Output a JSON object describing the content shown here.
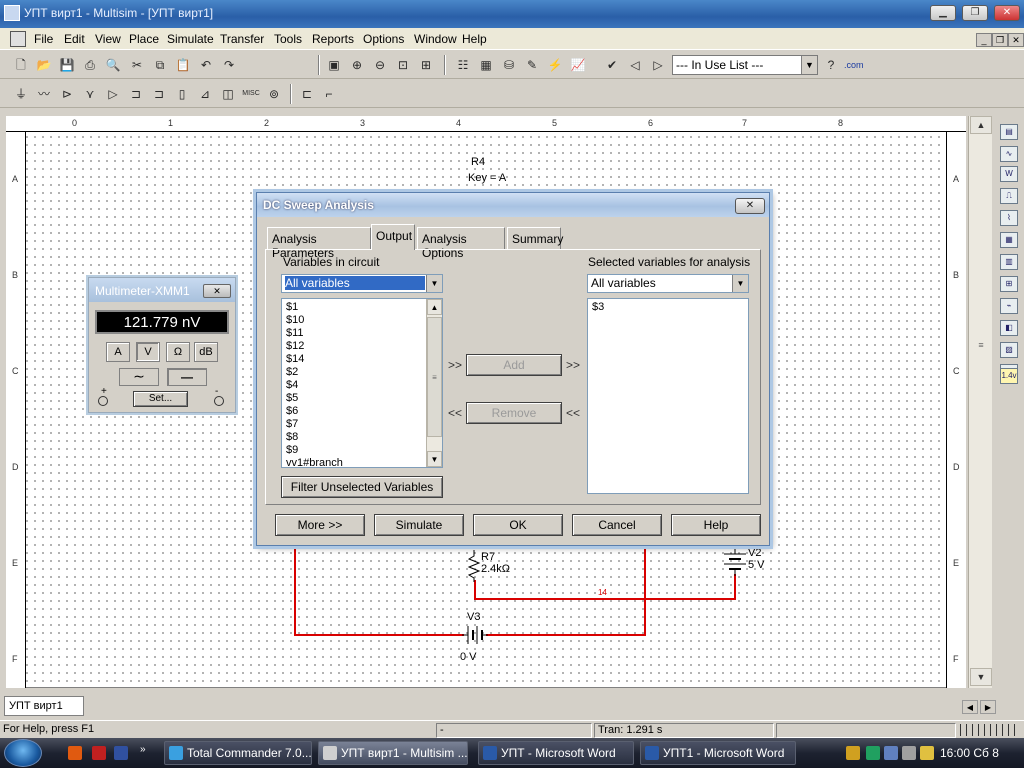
{
  "window": {
    "title": "УПТ вирт1 - Multisim - [УПТ вирт1]",
    "min_label": "▁",
    "max_label": "❐",
    "close_label": "✕"
  },
  "menu": [
    "File",
    "Edit",
    "View",
    "Place",
    "Simulate",
    "Transfer",
    "Tools",
    "Reports",
    "Options",
    "Window",
    "Help"
  ],
  "toolbar": {
    "in_use_list": "--- In Use List ---",
    "help_icon": "?",
    "com_label": ".com"
  },
  "ruler": {
    "top_marks": [
      "0",
      "1",
      "2",
      "3",
      "4",
      "5",
      "6",
      "7",
      "8"
    ],
    "left_marks": [
      "A",
      "B",
      "C",
      "D",
      "E",
      "F"
    ]
  },
  "schematic": {
    "r4_name": "R4",
    "r4_key": "Key = A",
    "r7_name": "R7",
    "r7_value": "2.4kΩ",
    "v2_name": "V2",
    "v2_value": "5 V",
    "v3_name": "V3",
    "v3_value": "0 V",
    "net_label": "14"
  },
  "multimeter": {
    "title": "Multimeter-XMM1",
    "display": "121.779 nV",
    "buttons": [
      "A",
      "V",
      "Ω",
      "dB"
    ],
    "set_label": "Set...",
    "plus": "+",
    "minus": "-"
  },
  "dialog": {
    "title": "DC Sweep Analysis",
    "close_label": "✕",
    "tabs": [
      "Analysis Parameters",
      "Output",
      "Analysis Options",
      "Summary"
    ],
    "active_tab": "Output",
    "variables_label": "Variables in circuit",
    "variables_filter": "All variables",
    "variables": [
      "$1",
      "$10",
      "$11",
      "$12",
      "$14",
      "$2",
      "$4",
      "$5",
      "$6",
      "$7",
      "$8",
      "$9",
      "vv1#branch"
    ],
    "selected_label": "Selected variables for analysis",
    "selected_filter": "All variables",
    "selected_variables": [
      "$3"
    ],
    "add_label": "Add",
    "remove_label": "Remove",
    "add_chev_left": ">>",
    "add_chev_right": ">>",
    "remove_chev_left": "<<",
    "remove_chev_right": "<<",
    "filter_label": "Filter Unselected Variables",
    "more_label": "More >>",
    "simulate_label": "Simulate",
    "ok_label": "OK",
    "cancel_label": "Cancel",
    "help_label": "Help"
  },
  "doc_tab": "УПТ вирт1",
  "status": {
    "help": "For Help, press F1",
    "cell2": "-",
    "tran": "Tran: 1.291 s"
  },
  "taskbar": {
    "tasks": [
      "Total Commander 7.0...",
      "УПТ вирт1 - Multisim ...",
      "УПТ - Microsoft Word",
      "УПТ1 - Microsoft Word"
    ],
    "clock": "16:00 Сб 8"
  }
}
